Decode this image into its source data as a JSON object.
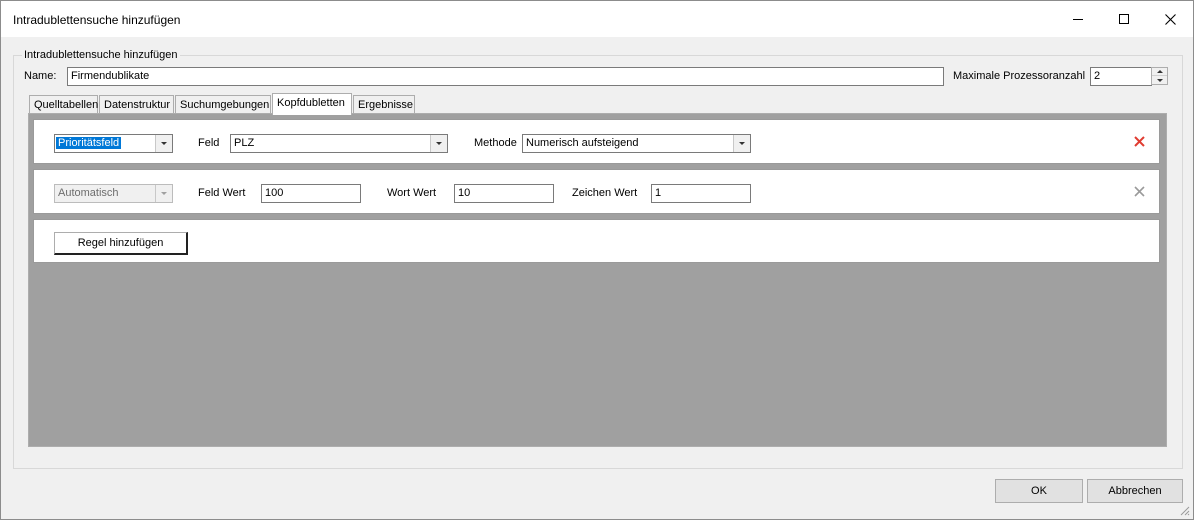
{
  "window": {
    "title": "Intradublettensuche hinzufügen",
    "minimize_icon": "minimize-icon",
    "maximize_icon": "maximize-icon",
    "close_icon": "close-icon"
  },
  "group": {
    "legend": "Intradublettensuche hinzufügen",
    "name_label": "Name:",
    "name_value": "Firmendublikate",
    "max_proc_label": "Maximale Prozessoranzahl",
    "max_proc_value": "2"
  },
  "tabs": [
    {
      "label": "Quelltabellen",
      "active": false
    },
    {
      "label": "Datenstruktur",
      "active": false
    },
    {
      "label": "Suchumgebungen",
      "active": false
    },
    {
      "label": "Kopfdubletten",
      "active": true
    },
    {
      "label": "Ergebnisse",
      "active": false
    }
  ],
  "rules": {
    "row1": {
      "type_value": "Prioritätsfeld",
      "feld_label": "Feld",
      "feld_value": "PLZ",
      "methode_label": "Methode",
      "methode_value": "Numerisch aufsteigend",
      "delete_icon": "delete-x-icon",
      "delete_color": "#e03c31"
    },
    "row2": {
      "type_value": "Automatisch",
      "feld_wert_label": "Feld Wert",
      "feld_wert_value": "100",
      "wort_wert_label": "Wort Wert",
      "wort_wert_value": "10",
      "zeichen_wert_label": "Zeichen Wert",
      "zeichen_wert_value": "1",
      "delete_icon": "delete-x-icon",
      "delete_color": "#9a9a9a"
    },
    "add_button_label": "Regel hinzufügen"
  },
  "footer": {
    "ok_label": "OK",
    "cancel_label": "Abbrechen"
  }
}
